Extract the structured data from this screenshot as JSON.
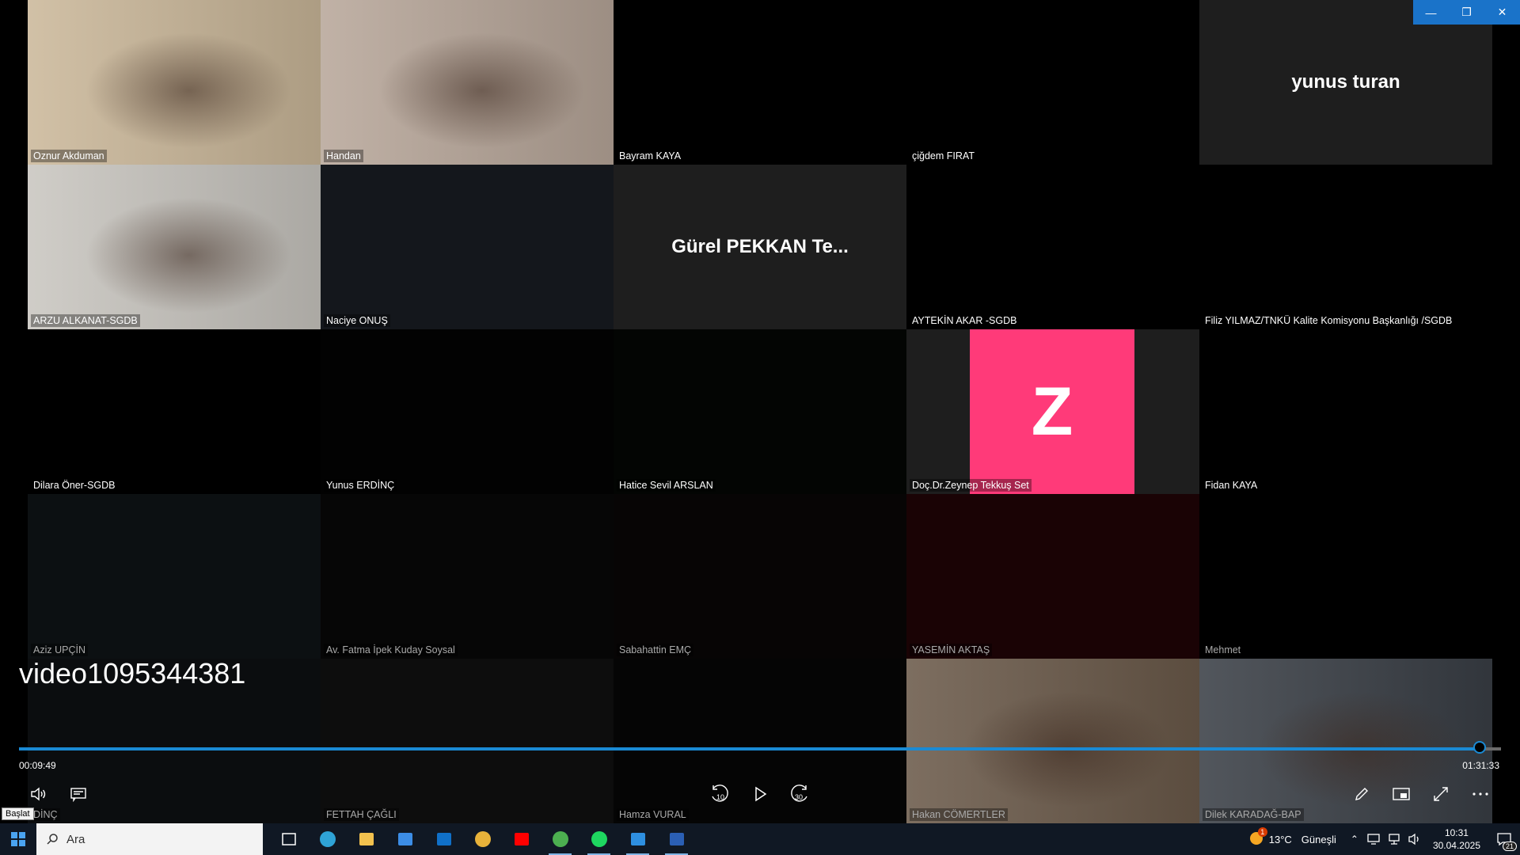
{
  "window": {
    "minimize": "—",
    "restore": "❐",
    "close": "✕"
  },
  "participants": [
    {
      "name": "Oznur Akduman",
      "video": true,
      "bg": "#cbb89a"
    },
    {
      "name": "Handan",
      "video": true,
      "bg": "#b8a79a"
    },
    {
      "name": "Bayram KAYA",
      "video": false,
      "bg": "#000000"
    },
    {
      "name": "çiğdem FIRAT",
      "video": false,
      "bg": "#000000"
    },
    {
      "name": "yunus turan",
      "video": false,
      "bg": "#1e1e1e",
      "display_name": "yunus turan",
      "hide_label": true
    },
    {
      "name": "ARZU ALKANAT-SGDB",
      "video": true,
      "bg": "#c9c6c0"
    },
    {
      "name": "Naciye ONUŞ",
      "video": false,
      "bg": "#14171c"
    },
    {
      "name": "Gürel PEKKAN Te...",
      "video": false,
      "bg": "#1e1e1e",
      "display_name": "Gürel PEKKAN Te...",
      "hide_label": true
    },
    {
      "name": "AYTEKİN AKAR -SGDB",
      "video": false,
      "bg": "#000000"
    },
    {
      "name": "Filiz YILMAZ/TNKÜ Kalite Komisyonu Başkanlığı /SGDB",
      "video": false,
      "bg": "#000000"
    },
    {
      "name": "Dilara Öner-SGDB",
      "video": false,
      "bg": "#000000"
    },
    {
      "name": "Yunus ERDİNÇ",
      "video": false,
      "bg": "#020202"
    },
    {
      "name": "Hatice Sevil ARSLAN",
      "video": false,
      "bg": "#030503"
    },
    {
      "name": "Doç.Dr.Zeynep Tekkuş Set",
      "video": false,
      "bg": "#1e1e1e",
      "avatar": "Z"
    },
    {
      "name": "Fidan KAYA",
      "video": false,
      "bg": "#000000"
    },
    {
      "name": "Aziz UPÇİN",
      "video": false,
      "bg": "#0c1012",
      "dim": true
    },
    {
      "name": "Av. Fatma İpek Kuday Soysal",
      "video": false,
      "bg": "#060606",
      "dim": true
    },
    {
      "name": "Sabahattin EMÇ",
      "video": false,
      "bg": "#070505",
      "dim": true
    },
    {
      "name": "YASEMİN AKTAŞ",
      "video": false,
      "bg": "#1a0305",
      "dim": true
    },
    {
      "name": "Mehmet",
      "video": false,
      "bg": "#000000",
      "dim": true
    },
    {
      "name": "DİNÇ",
      "video": false,
      "bg": "#0b0d0f",
      "dim": true
    },
    {
      "name": "FETTAH ÇAĞLI",
      "video": false,
      "bg": "#0d0d0d",
      "dim": true
    },
    {
      "name": "Hamza VURAL",
      "video": false,
      "bg": "#050505",
      "dim": true
    },
    {
      "name": "Hakan CÖMERTLER",
      "video": true,
      "bg": "#6b5a4a",
      "dim": true
    },
    {
      "name": "Dilek KARADAĞ-BAP",
      "video": true,
      "bg": "#3a3f46",
      "dim": true
    }
  ],
  "player": {
    "title": "video1095344381",
    "current_time": "00:09:49",
    "total_time": "01:31:33",
    "progress": 0.9857,
    "tooltip": "Başlat",
    "buttons": [
      "volume-icon",
      "captions-icon",
      "rewind-10-icon",
      "play-icon",
      "forward-30-icon",
      "edit-icon",
      "miniplayer-icon",
      "fullscreen-icon",
      "more-icon"
    ],
    "rewind_label": "10",
    "forward_label": "30"
  },
  "taskbar": {
    "search_placeholder": "Ara",
    "apps": [
      "task-view-icon",
      "edge-icon",
      "file-explorer-icon",
      "store-icon",
      "outlook-icon",
      "chrome-icon",
      "youtube-icon",
      "chrome-profile-icon",
      "spotify-icon",
      "media-player-icon",
      "word-icon"
    ],
    "weather_temp": "13°C",
    "weather_text": "Güneşli",
    "weather_badge": "1",
    "time": "10:31",
    "date": "30.04.2025",
    "notif_count": "21"
  },
  "colors": {
    "accent": "#1a8ad4",
    "avatar_z": "#ff3a79",
    "taskbar": "#101824"
  }
}
